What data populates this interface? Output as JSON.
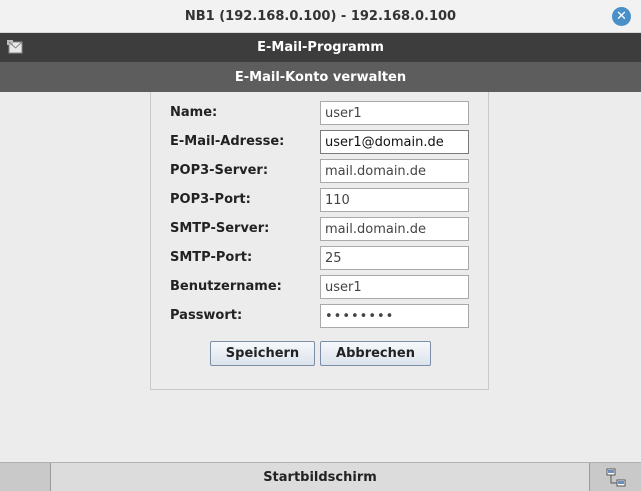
{
  "window": {
    "title": "NB1 (192.168.0.100) - 192.168.0.100",
    "close_glyph": "✕"
  },
  "app": {
    "title": "E-Mail-Programm",
    "icon": "mail-app-icon"
  },
  "dialog": {
    "title": "E-Mail-Konto verwalten"
  },
  "form": {
    "fields": [
      {
        "label": "Name:",
        "value": "user1"
      },
      {
        "label": "E-Mail-Adresse:",
        "value": "user1@domain.de"
      },
      {
        "label": "POP3-Server:",
        "value": "mail.domain.de"
      },
      {
        "label": "POP3-Port:",
        "value": "110"
      },
      {
        "label": "SMTP-Server:",
        "value": "mail.domain.de"
      },
      {
        "label": "SMTP-Port:",
        "value": "25"
      },
      {
        "label": "Benutzername:",
        "value": "user1"
      },
      {
        "label": "Passwort:",
        "value": "••••••••"
      }
    ],
    "save_label": "Speichern",
    "cancel_label": "Abbrechen"
  },
  "taskbar": {
    "start_label": "Startbildschirm",
    "network_icon": "network-icon"
  },
  "colors": {
    "close_button": "#4a90c8",
    "app_bar": "#3d3d3d",
    "dialog_bar": "#5d5d5d"
  }
}
